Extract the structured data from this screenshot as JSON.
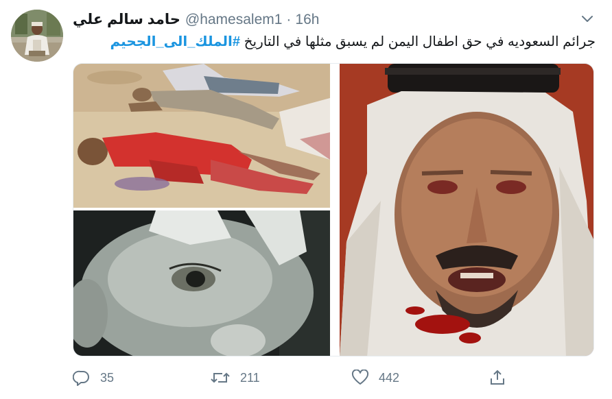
{
  "tweet": {
    "display_name": "حامد سالم علي",
    "handle": "@hamesalem1",
    "separator": "·",
    "time": "16h",
    "text": "جرائم السعوديه في حق اطفال اليمن لم يسبق  مثلها في التاريخ ",
    "hashtag": "#الملك_الى_الجحيم"
  },
  "actions": {
    "reply_count": "35",
    "retweet_count": "211",
    "like_count": "442"
  },
  "icons": {
    "caret": "chevron-down-icon",
    "reply": "reply-icon",
    "retweet": "retweet-icon",
    "like": "heart-icon",
    "share": "share-icon"
  },
  "colors": {
    "hashtag": "#1b95e0",
    "muted": "#657786",
    "text": "#14171a"
  }
}
